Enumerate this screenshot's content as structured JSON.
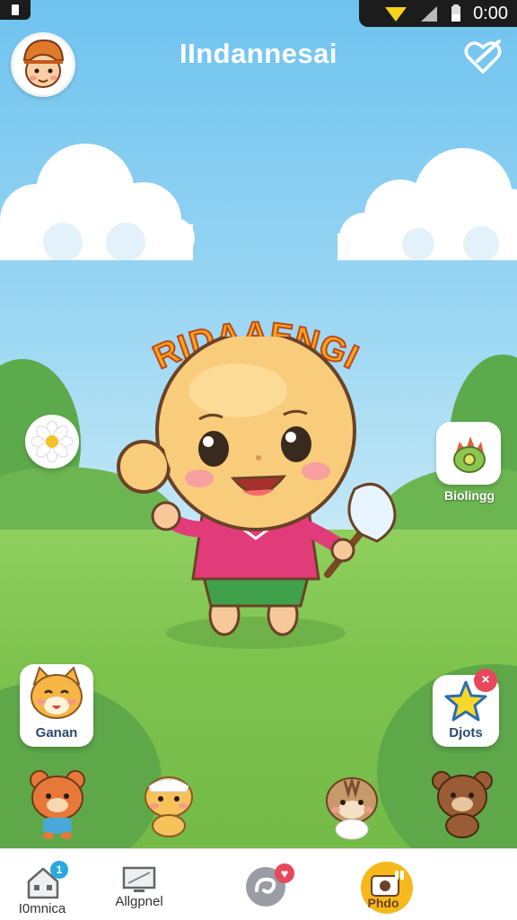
{
  "app": {
    "title": "IIndannesai"
  },
  "status": {
    "time": "0:00"
  },
  "character": {
    "name_arc": "RIDAAENGI"
  },
  "side_buttons": {
    "right_top": {
      "label": "Biolingg",
      "icon": "sprout-icon"
    },
    "left_bottom": {
      "label": "Ganan",
      "icon": "cat-face-icon"
    },
    "right_bottom": {
      "label": "Djots",
      "icon": "star-icon"
    }
  },
  "nav": {
    "items": [
      {
        "label": "I0mnica",
        "icon": "house-icon",
        "badge": "1"
      },
      {
        "label": "Allgpnel",
        "icon": "monitor-icon"
      },
      {
        "label": "",
        "icon": "swirl-icon"
      },
      {
        "label": "Phdo",
        "icon": "camera-icon"
      }
    ]
  },
  "colors": {
    "accent": "#f7a41c",
    "sky": "#6ec3ef",
    "grass": "#7fc34f",
    "badge": "#e8485c"
  }
}
